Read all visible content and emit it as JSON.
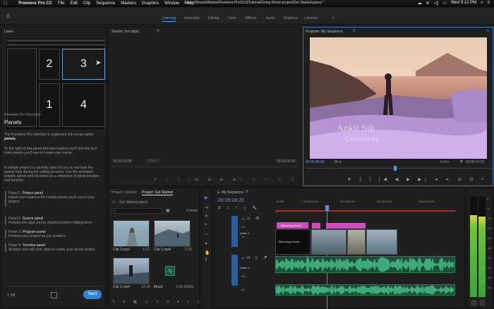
{
  "menubar": {
    "apple": "",
    "app": "Premiere Pro CC",
    "items": [
      "File",
      "Edit",
      "Clip",
      "Sequence",
      "Markers",
      "Graphics",
      "Window",
      "Help"
    ],
    "title": "/Users/Shared/Adobe/Premiere Pro/13.0/Tutorial/Going Home project/Get Started.prproj *",
    "clock": "Wed 9:12 PM"
  },
  "workspaces": {
    "tabs": [
      "Learning",
      "Assembly",
      "Editing",
      "Color",
      "Effects",
      "Audio",
      "Graphics",
      "Libraries"
    ],
    "active": "Learning",
    "more": "»"
  },
  "learn": {
    "title": "Learn",
    "cells": [
      "2",
      "3",
      "1",
      "4"
    ],
    "overview": "Premiere Pro Overview",
    "heading": "Panels",
    "p1": [
      "The Premiere Pro interface is organized into areas called",
      "panels."
    ],
    "p2": [
      "To the right of this panel (the learn panel) you'll find the four",
      "main panels you'll use to create your movie."
    ],
    "p3": [
      "A sample project is currently open for you to see how the",
      "panels look during the editing process. Use the animated",
      "graphic above and list below as a reference of panel location",
      "and function."
    ],
    "items": [
      {
        "num": "Panel 1:",
        "name": "Project panel",
        "desc": [
          "Import and organize the media assets you'll use in your",
          "project."
        ]
      },
      {
        "num": "Panel 2:",
        "name": "Source panel",
        "desc": [
          "Preview the clips you've imported before editing them."
        ]
      },
      {
        "num": "Panel 3:",
        "name": "Program panel",
        "desc": [
          "Preview your project as you create it."
        ]
      },
      {
        "num": "Panel 4:",
        "name": "Timeline panel",
        "desc": [
          "Arrange and edit your clips to create your actual project"
        ]
      }
    ],
    "all": "All",
    "next": "Next"
  },
  "source": {
    "title": "Source: (no clips)",
    "menu": "≡",
    "timecode": "00;00;00;00",
    "page": "Page 1",
    "timecode_end": "00;00;00;00"
  },
  "program": {
    "title": "Program: My Sequence",
    "menu": "≡",
    "overlay_line1": "Ankit Sth",
    "overlay_line2": "Guatemala",
    "timecode": "00:00:06:20",
    "fit": "Fit",
    "quality": "Full",
    "duration": "00:00:13:22",
    "progress": 0.48
  },
  "project": {
    "tab1": "Project: Untitled",
    "tab2": "Project: Get Started",
    "file": "Get Started.prproj",
    "items_count": "4 Items",
    "clips": [
      {
        "name": "Clip 3.mp4",
        "dur": "4:12"
      },
      {
        "name": "Clip 1.mp4",
        "dur": "5:15"
      },
      {
        "name": "Clip 2.mp4",
        "dur": "12:14"
      },
      {
        "name": "Music",
        "dur": "1:05:10909"
      }
    ]
  },
  "timeline": {
    "title": "My Sequence",
    "menu": "≡",
    "timecode": "00:00:06:20",
    "ruler": [
      "00:00",
      "00:00:04:23",
      "00:00:09:23",
      "00:00:14:23",
      "00:00:19:23"
    ],
    "tracks_video": [
      "V3",
      "V2",
      "V1"
    ],
    "tracks_audio": [
      "A1",
      "A2",
      "A3"
    ],
    "video1": "Video 1",
    "audio1": "Audio 1",
    "clips": [
      "Returning Home",
      "Returning Home"
    ]
  },
  "meter": {
    "labels": [
      "0",
      "-6",
      "-12",
      "-18",
      "-24",
      "-30",
      "-36",
      "-42",
      "-48",
      "-54"
    ],
    "s1": "S",
    "s2": "S",
    "level_left": 0.82,
    "level_right": 0.8
  }
}
